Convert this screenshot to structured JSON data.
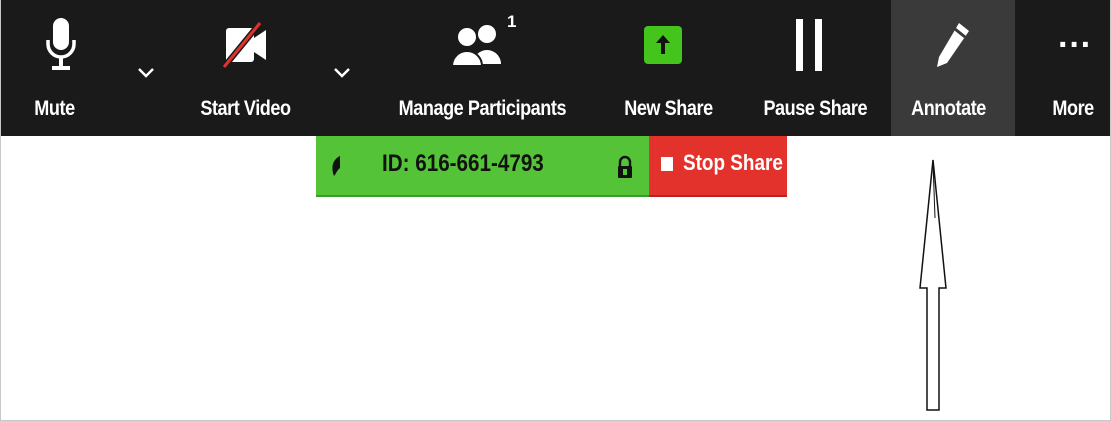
{
  "toolbar": {
    "mute_label": "Mute",
    "start_video_label": "Start Video",
    "manage_participants_label": "Manage Participants",
    "participant_count": "1",
    "new_share_label": "New Share",
    "pause_share_label": "Pause Share",
    "annotate_label": "Annotate",
    "more_label": "More",
    "more_glyph": "···"
  },
  "share_bar": {
    "meeting_id": "ID: 616-661-4793",
    "stop_share_label": "Stop Share"
  },
  "colors": {
    "toolbar_bg": "#1a1a1a",
    "active_bg": "#3a3a3a",
    "share_green": "#55c338",
    "new_share_green": "#44c51c",
    "stop_red": "#e3312c",
    "video_slash_red": "#e0312b"
  },
  "icons": {
    "mute": "microphone-icon",
    "caret": "chevron-down-icon",
    "video": "video-off-icon",
    "participants": "participants-icon",
    "new_share": "upload-arrow-icon",
    "pause": "pause-icon",
    "annotate": "pencil-icon",
    "more": "ellipsis-icon",
    "share_indicator": "share-status-icon",
    "lock": "lock-icon",
    "stop": "stop-square-icon",
    "pointer": "up-arrow-annotation"
  }
}
